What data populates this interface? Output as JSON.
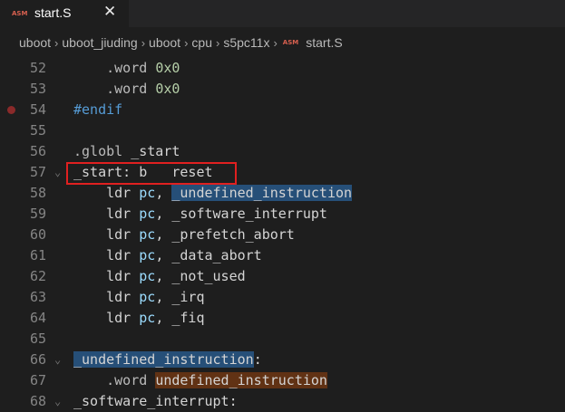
{
  "tab": {
    "icon": "ASM",
    "title": "start.S",
    "close": "✕"
  },
  "breadcrumb": [
    "uboot",
    "uboot_jiuding",
    "uboot",
    "cpu",
    "s5pc11x"
  ],
  "breadcrumb_file": {
    "icon": "ASM",
    "name": "start.S"
  },
  "lines": [
    {
      "n": "52",
      "indent": "    ",
      "parts": [
        [
          ".word ",
          "dot"
        ],
        [
          "0x0",
          "num"
        ]
      ]
    },
    {
      "n": "53",
      "indent": "    ",
      "parts": [
        [
          ".word ",
          "dot"
        ],
        [
          "0x0",
          "num"
        ]
      ]
    },
    {
      "n": "54",
      "indent": "",
      "bp": true,
      "parts": [
        [
          "#endif",
          "pre"
        ]
      ]
    },
    {
      "n": "55",
      "indent": "",
      "parts": []
    },
    {
      "n": "56",
      "indent": "",
      "parts": [
        [
          ".globl ",
          "dot"
        ],
        [
          "_start",
          "def"
        ]
      ]
    },
    {
      "n": "57",
      "indent": "",
      "fold": true,
      "parts": [
        [
          "_start: b   reset",
          "def"
        ]
      ]
    },
    {
      "n": "58",
      "indent": "    ",
      "parts": [
        [
          "ldr ",
          "def"
        ],
        [
          "pc",
          "kw"
        ],
        [
          ", ",
          "def"
        ],
        [
          "_undefined_instruction",
          "hlb"
        ]
      ]
    },
    {
      "n": "59",
      "indent": "    ",
      "parts": [
        [
          "ldr ",
          "def"
        ],
        [
          "pc",
          "kw"
        ],
        [
          ", _software_interrupt",
          "def"
        ]
      ]
    },
    {
      "n": "60",
      "indent": "    ",
      "parts": [
        [
          "ldr ",
          "def"
        ],
        [
          "pc",
          "kw"
        ],
        [
          ", _prefetch_abort",
          "def"
        ]
      ]
    },
    {
      "n": "61",
      "indent": "    ",
      "parts": [
        [
          "ldr ",
          "def"
        ],
        [
          "pc",
          "kw"
        ],
        [
          ", _data_abort",
          "def"
        ]
      ]
    },
    {
      "n": "62",
      "indent": "    ",
      "parts": [
        [
          "ldr ",
          "def"
        ],
        [
          "pc",
          "kw"
        ],
        [
          ", _not_used",
          "def"
        ]
      ]
    },
    {
      "n": "63",
      "indent": "    ",
      "parts": [
        [
          "ldr ",
          "def"
        ],
        [
          "pc",
          "kw"
        ],
        [
          ", _irq",
          "def"
        ]
      ]
    },
    {
      "n": "64",
      "indent": "    ",
      "parts": [
        [
          "ldr ",
          "def"
        ],
        [
          "pc",
          "kw"
        ],
        [
          ", _fiq",
          "def"
        ]
      ]
    },
    {
      "n": "65",
      "indent": "",
      "parts": []
    },
    {
      "n": "66",
      "indent": "",
      "fold": true,
      "parts": [
        [
          "_undefined_instruction",
          "hlb"
        ],
        [
          ":",
          "def"
        ]
      ]
    },
    {
      "n": "67",
      "indent": "    ",
      "parts": [
        [
          ".word ",
          "dot"
        ],
        [
          "undefined_instruction",
          "hlo"
        ]
      ]
    },
    {
      "n": "68",
      "indent": "",
      "fold": true,
      "parts": [
        [
          "_software_interrupt:",
          "def"
        ]
      ]
    }
  ],
  "colors": {
    "highlight_box": "#e02020",
    "selection": "#264f78",
    "word_highlight": "#613214"
  }
}
